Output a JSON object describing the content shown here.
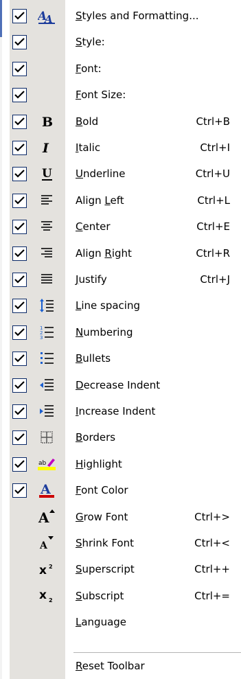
{
  "menu": {
    "items": [
      {
        "key": "styles",
        "pre": "",
        "acc": "S",
        "post": "tyles and Formatting...",
        "shortcut": "",
        "checked": true,
        "icon": "styles-formatting-icon"
      },
      {
        "key": "style",
        "pre": "",
        "acc": "S",
        "post": "tyle:",
        "shortcut": "",
        "checked": true,
        "icon": ""
      },
      {
        "key": "font",
        "pre": "",
        "acc": "F",
        "post": "ont:",
        "shortcut": "",
        "checked": true,
        "icon": ""
      },
      {
        "key": "font_size",
        "pre": "",
        "acc": "F",
        "post": "ont Size:",
        "shortcut": "",
        "checked": true,
        "icon": ""
      },
      {
        "key": "bold",
        "pre": "",
        "acc": "B",
        "post": "old",
        "shortcut": "Ctrl+B",
        "checked": true,
        "icon": "bold-icon"
      },
      {
        "key": "italic",
        "pre": "",
        "acc": "I",
        "post": "talic",
        "shortcut": "Ctrl+I",
        "checked": true,
        "icon": "italic-icon"
      },
      {
        "key": "underline",
        "pre": "",
        "acc": "U",
        "post": "nderline",
        "shortcut": "Ctrl+U",
        "checked": true,
        "icon": "underline-icon"
      },
      {
        "key": "align_left",
        "pre": "Align ",
        "acc": "L",
        "post": "eft",
        "shortcut": "Ctrl+L",
        "checked": true,
        "icon": "align-left-icon"
      },
      {
        "key": "center",
        "pre": "",
        "acc": "C",
        "post": "enter",
        "shortcut": "Ctrl+E",
        "checked": true,
        "icon": "align-center-icon"
      },
      {
        "key": "align_right",
        "pre": "Align ",
        "acc": "R",
        "post": "ight",
        "shortcut": "Ctrl+R",
        "checked": true,
        "icon": "align-right-icon"
      },
      {
        "key": "justify",
        "pre": "",
        "acc": "J",
        "post": "ustify",
        "shortcut": "Ctrl+J",
        "checked": true,
        "icon": "justify-icon"
      },
      {
        "key": "line_spacing",
        "pre": "",
        "acc": "L",
        "post": "ine spacing",
        "shortcut": "",
        "checked": true,
        "icon": "line-spacing-icon"
      },
      {
        "key": "numbering",
        "pre": "",
        "acc": "N",
        "post": "umbering",
        "shortcut": "",
        "checked": true,
        "icon": "numbering-icon"
      },
      {
        "key": "bullets",
        "pre": "",
        "acc": "B",
        "post": "ullets",
        "shortcut": "",
        "checked": true,
        "icon": "bullets-icon"
      },
      {
        "key": "decrease_indent",
        "pre": "",
        "acc": "D",
        "post": "ecrease Indent",
        "shortcut": "",
        "checked": true,
        "icon": "decrease-indent-icon"
      },
      {
        "key": "increase_indent",
        "pre": "",
        "acc": "I",
        "post": "ncrease Indent",
        "shortcut": "",
        "checked": true,
        "icon": "increase-indent-icon"
      },
      {
        "key": "borders",
        "pre": "",
        "acc": "B",
        "post": "orders",
        "shortcut": "",
        "checked": true,
        "icon": "borders-icon"
      },
      {
        "key": "highlight",
        "pre": "",
        "acc": "H",
        "post": "ighlight",
        "shortcut": "",
        "checked": true,
        "icon": "highlight-icon"
      },
      {
        "key": "font_color",
        "pre": "",
        "acc": "F",
        "post": "ont Color",
        "shortcut": "",
        "checked": true,
        "icon": "font-color-icon"
      },
      {
        "key": "grow_font",
        "pre": "",
        "acc": "G",
        "post": "row Font",
        "shortcut": "Ctrl+>",
        "checked": false,
        "icon": "grow-font-icon"
      },
      {
        "key": "shrink_font",
        "pre": "",
        "acc": "S",
        "post": "hrink Font",
        "shortcut": "Ctrl+<",
        "checked": false,
        "icon": "shrink-font-icon"
      },
      {
        "key": "superscript",
        "pre": "",
        "acc": "S",
        "post": "uperscript",
        "shortcut": "Ctrl++",
        "checked": false,
        "icon": "superscript-icon"
      },
      {
        "key": "subscript",
        "pre": "",
        "acc": "S",
        "post": "ubscript",
        "shortcut": "Ctrl+=",
        "checked": false,
        "icon": "subscript-icon"
      },
      {
        "key": "language",
        "pre": "",
        "acc": "L",
        "post": "anguage",
        "shortcut": "",
        "checked": false,
        "icon": ""
      }
    ],
    "reset": {
      "pre": "",
      "acc": "R",
      "post": "eset Toolbar"
    }
  },
  "colors": {
    "icon_column": "#e4e2de",
    "checkbox_border": "#0a2866",
    "check_mark": "#000000",
    "accent_blue": "#4f6fb7",
    "font_color_red": "#cc0000",
    "highlight_yellow": "#ffff00"
  }
}
